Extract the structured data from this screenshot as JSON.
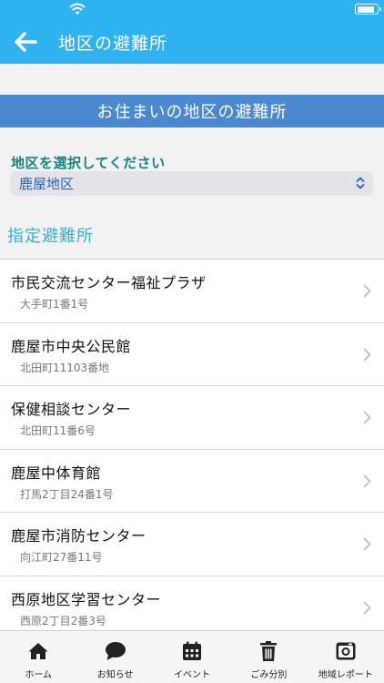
{
  "header": {
    "title": "地区の避難所"
  },
  "band": {
    "title": "お住まいの地区の避難所"
  },
  "district_select": {
    "label": "地区を選択してください",
    "value": "鹿屋地区"
  },
  "section": {
    "title": "指定避難所"
  },
  "shelters": [
    {
      "name": "市民交流センター福祉プラザ",
      "address": "大手町1番1号"
    },
    {
      "name": "鹿屋市中央公民館",
      "address": "北田町11103番地"
    },
    {
      "name": "保健相談センター",
      "address": "北田町11番6号"
    },
    {
      "name": "鹿屋中体育館",
      "address": "打馬2丁目24番1号"
    },
    {
      "name": "鹿屋市消防センター",
      "address": "向江町27番11号"
    },
    {
      "name": "西原地区学習センター",
      "address": "西原2丁目2番3号"
    }
  ],
  "tabs": [
    {
      "label": "ホーム",
      "icon": "home-icon"
    },
    {
      "label": "お知らせ",
      "icon": "chat-bubble-icon"
    },
    {
      "label": "イベント",
      "icon": "calendar-icon"
    },
    {
      "label": "ごみ分別",
      "icon": "trash-icon"
    },
    {
      "label": "地域レポート",
      "icon": "camera-icon"
    }
  ],
  "colors": {
    "header": "#2fb3f0",
    "band": "#4a88cf",
    "label": "#17847f",
    "section": "#35b0d6"
  }
}
